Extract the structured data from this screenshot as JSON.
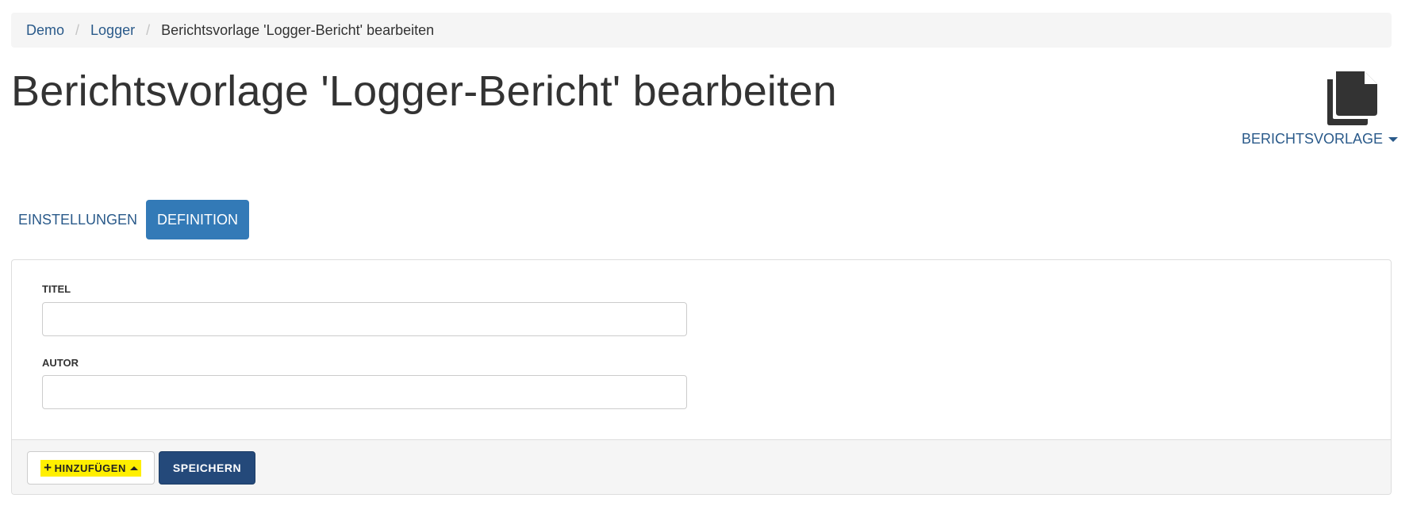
{
  "breadcrumb": {
    "items": [
      "Demo",
      "Logger"
    ],
    "current": "Berichtsvorlage 'Logger-Bericht' bearbeiten",
    "separator": "/"
  },
  "page": {
    "title": "Berichtsvorlage 'Logger-Bericht' bearbeiten",
    "icon": "copy-document-icon"
  },
  "template_menu": {
    "label": "BERICHTSVORLAGE",
    "icon": "caret-down-icon"
  },
  "tabs": [
    {
      "label": "EINSTELLUNGEN",
      "active": false
    },
    {
      "label": "DEFINITION",
      "active": true
    }
  ],
  "form": {
    "title": {
      "label": "TITEL",
      "value": "",
      "placeholder": ""
    },
    "author": {
      "label": "AUTOR",
      "value": "",
      "placeholder": ""
    }
  },
  "footer": {
    "add_label": "HINZUFÜGEN",
    "add_icon": "plus-icon",
    "save_label": "SPEICHERN"
  },
  "colors": {
    "link": "#2a5a8a",
    "active_tab": "#337ab7",
    "save_button": "#24497a",
    "highlight": "#ffef00"
  }
}
